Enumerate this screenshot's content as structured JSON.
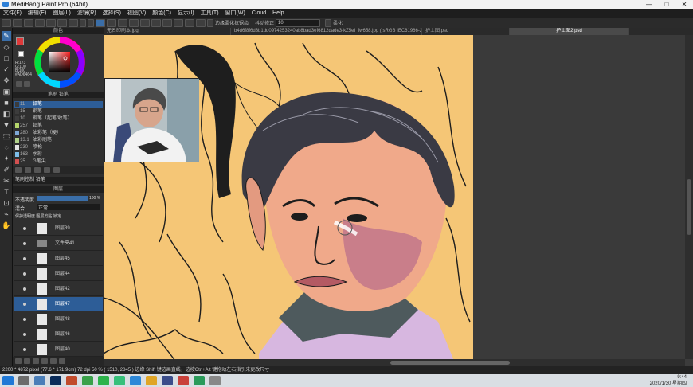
{
  "window": {
    "title": "MediBang Paint Pro (64bit)"
  },
  "menu": [
    "文件(F)",
    "编辑(E)",
    "图层(L)",
    "滤镜(R)",
    "选择(S)",
    "视图(V)",
    "颜色(C)",
    "显示(I)",
    "工具(T)",
    "窗口(W)",
    "Cloud",
    "Help"
  ],
  "toolbar": {
    "antialias_label": "边缘柔化抗锯齿",
    "correction_label": "抖动修正",
    "correction_value": "10",
    "extra_label": "柔化"
  },
  "tabs": [
    "无名印刷本.jpg",
    "b4d6f8f6d3b1dd0974253240ab8bad3ef6812dade3-kZ5eI_fw658.jpg ( sRGB IEC61966-2.1 )",
    "护士图.psd",
    "护士图2.psd"
  ],
  "color_panel": {
    "title": "颜色",
    "primary": "#e03a3a",
    "secondary": "#ffffff",
    "rgb": [
      "R:173",
      "G:100",
      "B:100"
    ],
    "hex": "#AD6464"
  },
  "brush_panel": {
    "tabs": [
      "笔刷",
      "铅笔"
    ],
    "items": [
      {
        "num": "11",
        "name": "铅笔",
        "selected": true,
        "color": "#3c3c3c"
      },
      {
        "num": "15",
        "name": "钢笔",
        "color": "#3c3c3c"
      },
      {
        "num": "10",
        "name": "钢笔（起笔/收笔）",
        "color": "#3c3c3c"
      },
      {
        "num": "257",
        "name": "铅笔",
        "color": "#b5d66b"
      },
      {
        "num": "280",
        "name": "油彩笔（硬）",
        "color": "#7fa9d9"
      },
      {
        "num": "13.1",
        "name": "油彩刷笔",
        "color": "#b0d28a"
      },
      {
        "num": "230",
        "name": "喷枪",
        "color": "#e4e4e4"
      },
      {
        "num": "163",
        "name": "水彩",
        "color": "#7dbde8"
      },
      {
        "num": "25",
        "name": "G笔尖",
        "color": "#d35050"
      }
    ],
    "footer_tabs": [
      "笔刷控制",
      "铅笔"
    ]
  },
  "layer_panel": {
    "title": "图层",
    "opacity_label": "不透明度",
    "opacity_value": "100 %",
    "blend_label": "混合",
    "blend_value": "正常",
    "protect_alpha": "保护透明度",
    "clipping": "图层剪贴",
    "lock": "锁定",
    "layers": [
      {
        "name": "图层39"
      },
      {
        "name": "文件夹41",
        "folder": true
      },
      {
        "name": "图层45"
      },
      {
        "name": "图层44"
      },
      {
        "name": "图层42"
      },
      {
        "name": "图层47",
        "selected": true
      },
      {
        "name": "图层48"
      },
      {
        "name": "图层46"
      },
      {
        "name": "图层40"
      }
    ]
  },
  "statusbar": {
    "text": "2200 * 4872 pixel   (77.6 * 171.9cm)   72 dpi   50 %   ( 1510, 2845 )   边缘 Shift 键边画直线，边按Ctrl+Alt 键拖动左右指引来更改尺寸"
  },
  "taskbar": {
    "time": "9:44",
    "date": "2020/1/30 星期四"
  }
}
